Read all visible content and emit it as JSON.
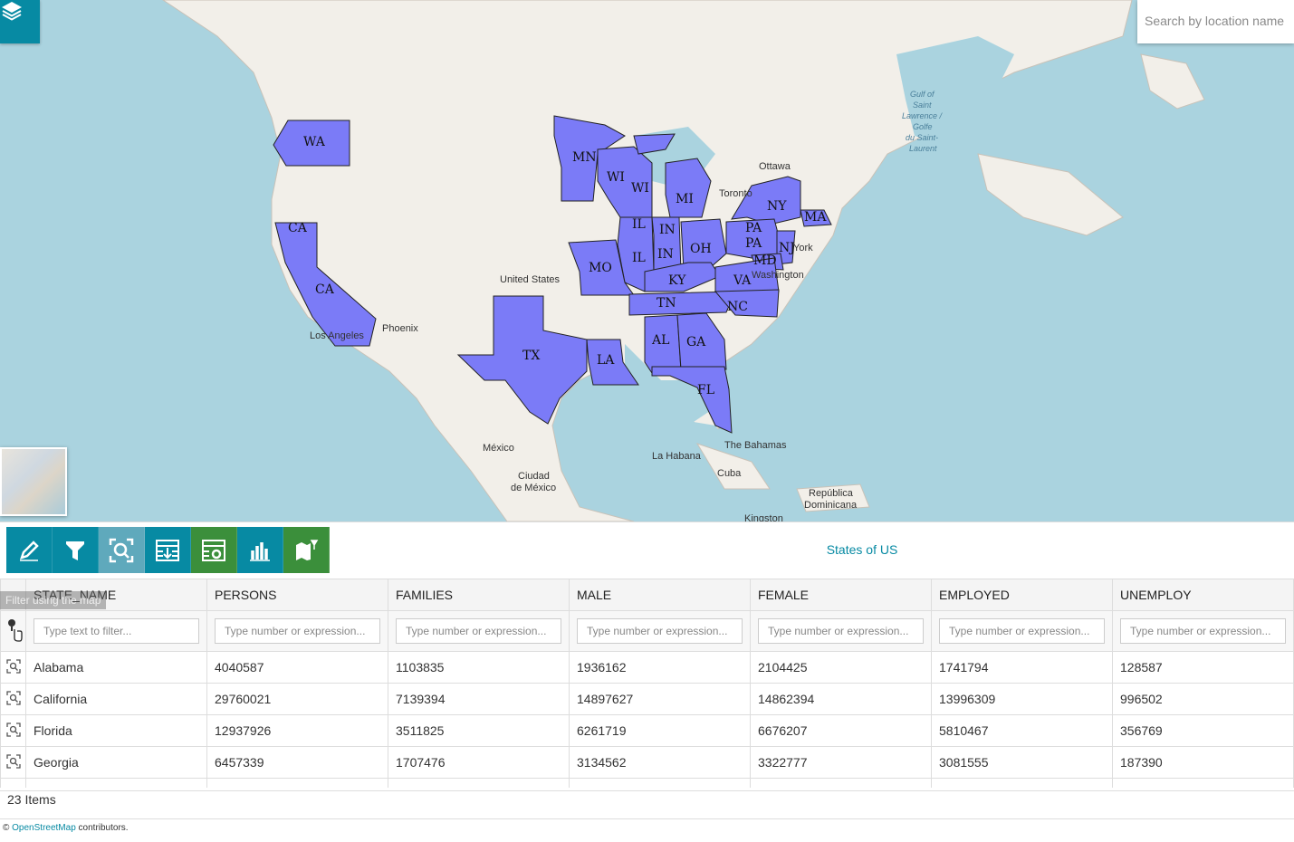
{
  "map": {
    "search_placeholder": "Search by location name",
    "place_labels": [
      "Ottawa",
      "Toronto",
      "United States",
      "Phoenix",
      "Los Angeles",
      "México",
      "Ciudad de México",
      "La Habana",
      "Cuba",
      "The Bahamas",
      "República Dominicana",
      "Kingston",
      "New York",
      "Washington"
    ],
    "water_labels": [
      "Gulf of Saint Lawrence / Golfe du Saint-Laurent"
    ],
    "state_labels": [
      "WA",
      "MN",
      "WI",
      "WI",
      "MI",
      "NY",
      "MA",
      "CA",
      "CA",
      "IL",
      "IL",
      "IN",
      "IN",
      "OH",
      "PA",
      "PA",
      "NJ",
      "MD",
      "KY",
      "VA",
      "MO",
      "TN",
      "NC",
      "TX",
      "LA",
      "AL",
      "GA",
      "FL"
    ],
    "highlight_color": "#7b7bf7"
  },
  "toolbar": {
    "buttons": [
      "edit",
      "filter",
      "zoom-to-features",
      "export",
      "settings",
      "chart",
      "map-layer"
    ]
  },
  "panel": {
    "title": "States of US",
    "tooltip": "Filter using the map",
    "columns": [
      "STATE_NAME",
      "PERSONS",
      "FAMILIES",
      "MALE",
      "FEMALE",
      "EMPLOYED",
      "UNEMPLOY"
    ],
    "filter_placeholders": [
      "Type text to filter...",
      "Type number or expression...",
      "Type number or expression...",
      "Type number or expression...",
      "Type number or expression...",
      "Type number or expression...",
      "Type number or expression..."
    ],
    "rows": [
      [
        "Alabama",
        "4040587",
        "1103835",
        "1936162",
        "2104425",
        "1741794",
        "128587"
      ],
      [
        "California",
        "29760021",
        "7139394",
        "14897627",
        "14862394",
        "13996309",
        "996502"
      ],
      [
        "Florida",
        "12937926",
        "3511825",
        "6261719",
        "6676207",
        "5810467",
        "356769"
      ],
      [
        "Georgia",
        "6457339",
        "1707476",
        "3134562",
        "3322777",
        "3081555",
        "187390"
      ]
    ],
    "items_count": "23 Items",
    "attribution_prefix": "©",
    "attribution_link": "OpenStreetMap",
    "attribution_suffix": "contributors."
  }
}
